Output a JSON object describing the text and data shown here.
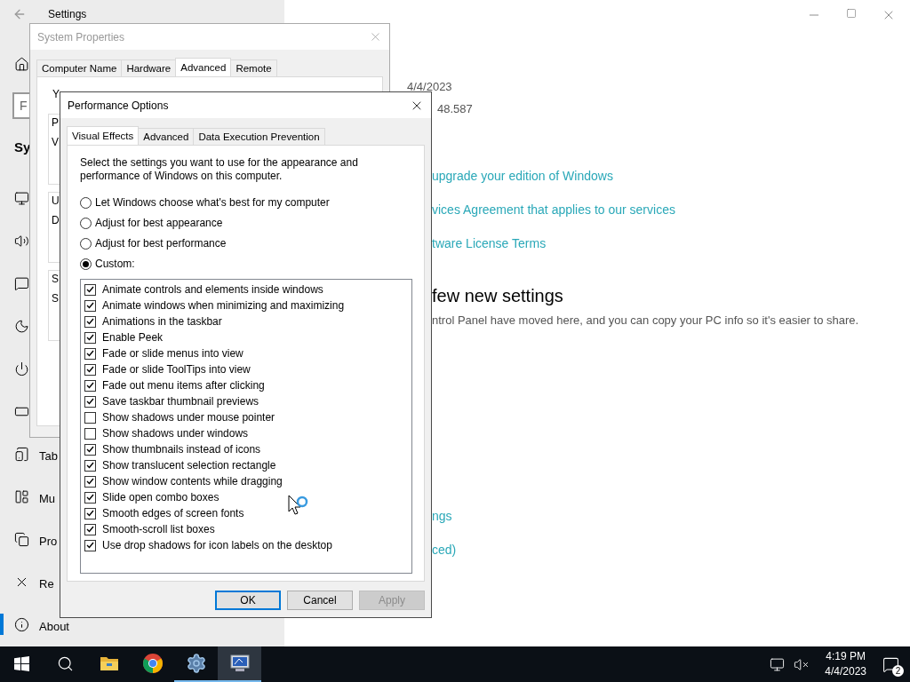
{
  "settings": {
    "title": "Settings",
    "search": {
      "placeholder": "F"
    },
    "heading": "Sy",
    "nav": [
      {
        "label": "Tab",
        "selected": false
      },
      {
        "label": "Mu",
        "selected": false
      },
      {
        "label": "Pro",
        "selected": false
      },
      {
        "label": "Re",
        "selected": false
      },
      {
        "label": "About",
        "selected": true
      }
    ],
    "content": {
      "date": "4/4/2023",
      "build": "48.587",
      "links": [
        "upgrade your edition of Windows",
        "vices Agreement that applies to our services",
        "tware License Terms"
      ],
      "heading": "few new settings",
      "description": "ntrol Panel have moved here, and you can copy your PC info so it's easier to share.",
      "more_links": [
        "ngs",
        "ced)"
      ]
    }
  },
  "system_properties": {
    "title": "System Properties",
    "tabs": [
      {
        "label": "Computer Name",
        "selected": false
      },
      {
        "label": "Hardware",
        "selected": false
      },
      {
        "label": "Advanced",
        "selected": true
      },
      {
        "label": "Remote",
        "selected": false
      }
    ],
    "intro": "Y",
    "group_boxes": [
      {
        "lines": [
          "P",
          "V"
        ]
      },
      {
        "lines": [
          "U",
          "D"
        ]
      },
      {
        "lines": [
          "S",
          "S"
        ]
      }
    ]
  },
  "performance_options": {
    "title": "Performance Options",
    "tabs": [
      {
        "label": "Visual Effects",
        "selected": true
      },
      {
        "label": "Advanced",
        "selected": false
      },
      {
        "label": "Data Execution Prevention",
        "selected": false
      }
    ],
    "intro": "Select the settings you want to use for the appearance and performance of Windows on this computer.",
    "radios": [
      {
        "label": "Let Windows choose what's best for my computer",
        "selected": false
      },
      {
        "label": "Adjust for best appearance",
        "selected": false
      },
      {
        "label": "Adjust for best performance",
        "selected": false
      },
      {
        "label": "Custom:",
        "selected": true
      }
    ],
    "effects": [
      {
        "label": "Animate controls and elements inside windows",
        "checked": true
      },
      {
        "label": "Animate windows when minimizing and maximizing",
        "checked": true
      },
      {
        "label": "Animations in the taskbar",
        "checked": true
      },
      {
        "label": "Enable Peek",
        "checked": true
      },
      {
        "label": "Fade or slide menus into view",
        "checked": true
      },
      {
        "label": "Fade or slide ToolTips into view",
        "checked": true
      },
      {
        "label": "Fade out menu items after clicking",
        "checked": true
      },
      {
        "label": "Save taskbar thumbnail previews",
        "checked": true
      },
      {
        "label": "Show shadows under mouse pointer",
        "checked": false
      },
      {
        "label": "Show shadows under windows",
        "checked": false
      },
      {
        "label": "Show thumbnails instead of icons",
        "checked": true
      },
      {
        "label": "Show translucent selection rectangle",
        "checked": true
      },
      {
        "label": "Show window contents while dragging",
        "checked": true
      },
      {
        "label": "Slide open combo boxes",
        "checked": true
      },
      {
        "label": "Smooth edges of screen fonts",
        "checked": true
      },
      {
        "label": "Smooth-scroll list boxes",
        "checked": true
      },
      {
        "label": "Use drop shadows for icon labels on the desktop",
        "checked": true
      }
    ],
    "buttons": [
      {
        "label": "OK",
        "kind": "default",
        "disabled": false
      },
      {
        "label": "Cancel",
        "kind": "normal",
        "disabled": false
      },
      {
        "label": "Apply",
        "kind": "normal",
        "disabled": true
      }
    ]
  },
  "taskbar": {
    "apps": [
      {
        "running": false,
        "selected": false
      },
      {
        "running": false,
        "selected": false
      },
      {
        "running": true,
        "selected": false
      },
      {
        "running": true,
        "selected": true
      }
    ],
    "time": "4:19 PM",
    "date": "4/4/2023",
    "notification_count": "2"
  }
}
